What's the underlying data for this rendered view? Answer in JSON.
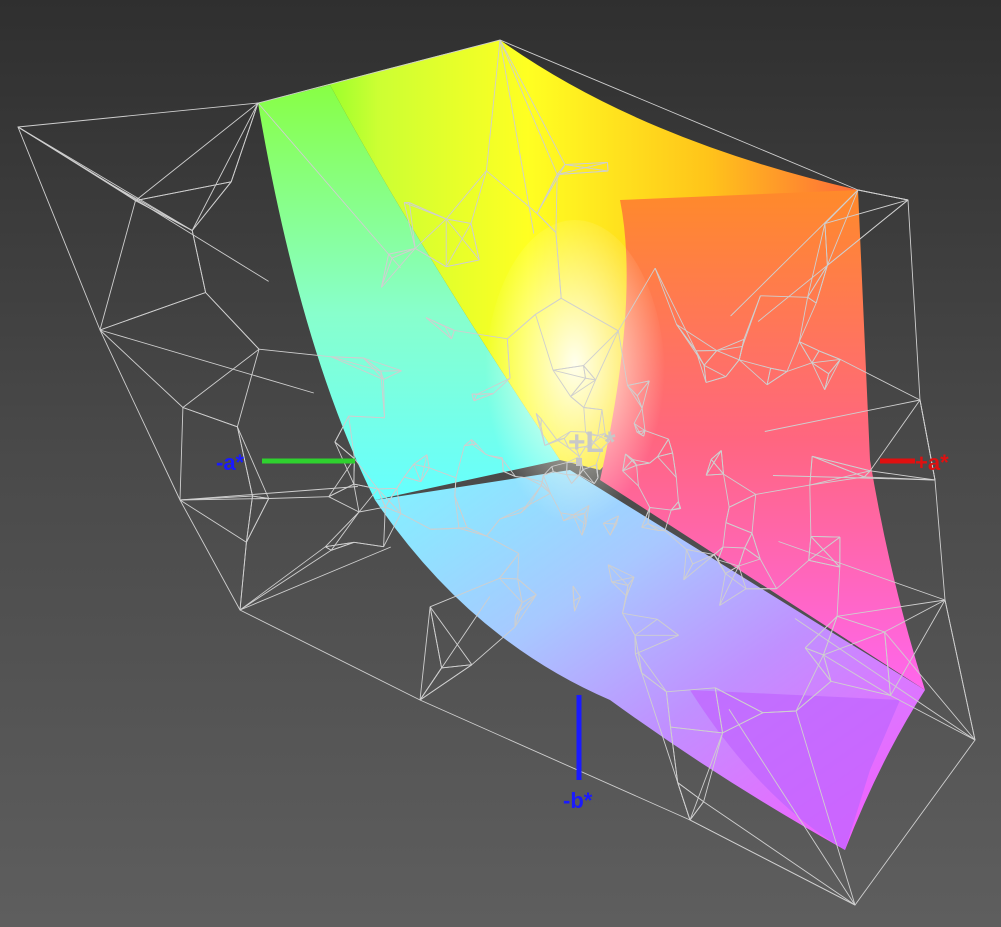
{
  "axes": {
    "plus_L": {
      "label": "+L*",
      "color": "#c8c8c8"
    },
    "minus_a": {
      "label": "-a*",
      "color": "#1a1aff",
      "line_color": "#2fd12f"
    },
    "plus_a": {
      "label": "+a*",
      "color": "#e01010",
      "line_color": "#e01010"
    },
    "minus_b": {
      "label": "-b*",
      "color": "#1a1aff",
      "line_color": "#1a1aff"
    }
  },
  "colors": {
    "wireframe": "#cfcfcf",
    "background_top": "#2f2f2f",
    "background_bottom": "#5e5e5e",
    "gamut_yellow": "#ffff1a",
    "gamut_green": "#55ff22",
    "gamut_cyan": "#55ffff",
    "gamut_blue": "#7f90ff",
    "gamut_magenta": "#ff55ff",
    "gamut_red": "#ff4a6a",
    "gamut_orange": "#ff8a2a",
    "gamut_white": "#ffffee"
  }
}
